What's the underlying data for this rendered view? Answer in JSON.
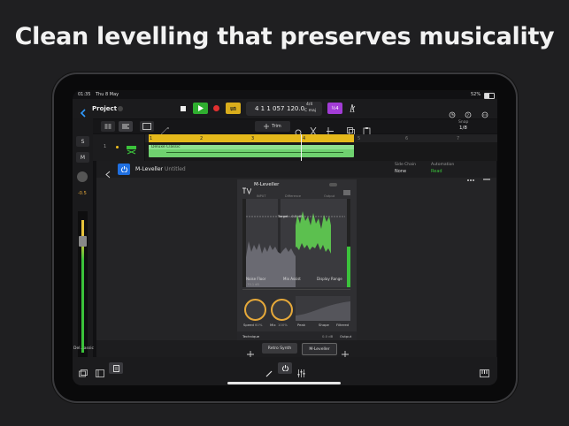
{
  "headline": "Clean levelling that preserves musicality",
  "status": {
    "time": "01:35",
    "date": "Thu 8 May",
    "battery": "52%"
  },
  "toolbar": {
    "project": "Project",
    "position": "4 1 1 057",
    "tempo": "120.0",
    "signature": "4/4",
    "key": "C maj",
    "count_in": "½4",
    "trim": "Trim",
    "snap_label": "Snap",
    "snap_value": "1/8"
  },
  "tracks": {
    "ruler": [
      "1",
      "2",
      "3",
      "4",
      "5",
      "6",
      "7"
    ],
    "region_name": "Deluxe Classic",
    "solo": "S",
    "mute": "M",
    "volume": "-0.5"
  },
  "plugin": {
    "name": "M-Leveller",
    "preset": "Untitled",
    "sidechain_label": "Side Chain",
    "sidechain_value": "None",
    "automation_label": "Automation",
    "automation_value": "Read",
    "panel_title": "M-Leveller",
    "meter_labels": [
      "INPUT",
      "Difference",
      "Output"
    ],
    "target_label": "Target",
    "target_value": "-0.5 dB",
    "noise_floor": "Noise Floor",
    "noise_floor_value": "-70.1 dB",
    "mix_assist": "Mix Assist",
    "display_range": "Display Range",
    "speed": "Speed",
    "speed_value": "60%",
    "mix": "Mix",
    "mix_value": "100%",
    "punch": "Peak",
    "shape": "Shape",
    "filtered": "Filtered",
    "technique": "Technique",
    "output_label": "Output",
    "output_value": "0.0 dB"
  },
  "chain": {
    "slot1": "Retro Synth",
    "slot2": "M-Leveller"
  },
  "mixer_strip_name": "Del...assic",
  "colors": {
    "accent": "#f0c020",
    "region": "#6fd16f",
    "knob": "#e6a93a",
    "waveform": "#5cc04f"
  }
}
